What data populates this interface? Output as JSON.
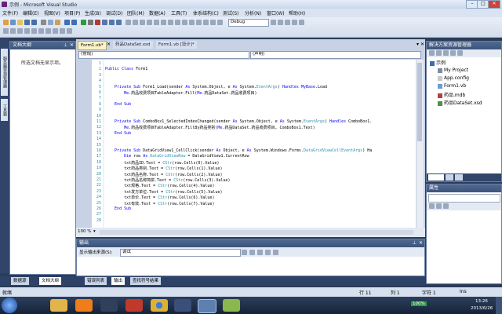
{
  "window": {
    "title": "示例 - Microsoft Visual Studio"
  },
  "menu": [
    "文件(F)",
    "编辑(E)",
    "视图(V)",
    "项目(P)",
    "生成(B)",
    "调试(D)",
    "团队(M)",
    "数据(A)",
    "工具(T)",
    "体系结构(C)",
    "测试(S)",
    "分析(N)",
    "窗口(W)",
    "帮助(H)"
  ],
  "toolbar": {
    "config": "Debug"
  },
  "doc_outline": {
    "title": "文档大纲",
    "message": "所选文档无显示项。"
  },
  "left_side_tabs": [
    "服务器资源管理器",
    "工具箱"
  ],
  "editor": {
    "tabs": [
      "Form1.vb*",
      "药品DataSet.xsd",
      "Form1.vb [设计]*"
    ],
    "left_combo": "(常规)",
    "right_combo": "(声明)",
    "zoom": "100 %",
    "lines": [
      {
        "n": "1",
        "t": ""
      },
      {
        "n": "2",
        "t": "Public Class Form1"
      },
      {
        "n": "3",
        "t": ""
      },
      {
        "n": "4",
        "t": ""
      },
      {
        "n": "5",
        "t": "    Private Sub Form1_Load(sender As System.Object, e As System.EventArgs) Handles MyBase.Load"
      },
      {
        "n": "6",
        "t": "        Me.药品收费项目TableAdapter.Fill(Me.药品DataSet.药品收费项目)"
      },
      {
        "n": "7",
        "t": ""
      },
      {
        "n": "8",
        "t": "    End Sub"
      },
      {
        "n": "9",
        "t": ""
      },
      {
        "n": "10",
        "t": ""
      },
      {
        "n": "11",
        "t": "    Private Sub ComboBox1_SelectedIndexChanged(sender As System.Object, e As System.EventArgs) Handles ComboBox1."
      },
      {
        "n": "12",
        "t": "        Me.药品收费项目TableAdapter.FillBy药品类别(Me.药品DataSet.药品收费项目, ComboBox1.Text)"
      },
      {
        "n": "13",
        "t": "    End Sub"
      },
      {
        "n": "14",
        "t": ""
      },
      {
        "n": "15",
        "t": ""
      },
      {
        "n": "16",
        "t": "    Private Sub DataGridView1_CellClick(sender As Object, e As System.Windows.Forms.DataGridViewCellEventArgs) Ha"
      },
      {
        "n": "17",
        "t": "        Dim row As DataGridViewRow = DataGridView1.CurrentRow"
      },
      {
        "n": "18",
        "t": "        txt药品ID.Text = CStr(row.Cells(0).Value)"
      },
      {
        "n": "19",
        "t": "        txt药品类别.Text = CStr(row.Cells(1).Value)"
      },
      {
        "n": "20",
        "t": "        txt药品名称.Text = CStr(row.Cells(2).Value)"
      },
      {
        "n": "21",
        "t": "        txt药品名称简拼.Text = CStr(row.Cells(3).Value)"
      },
      {
        "n": "22",
        "t": "        txt规格.Text = CStr(row.Cells(4).Value)"
      },
      {
        "n": "23",
        "t": "        txt发方单位.Text = CStr(row.Cells(5).Value)"
      },
      {
        "n": "24",
        "t": "        txt单价.Text = CStr(row.Cells(6).Value)"
      },
      {
        "n": "25",
        "t": "        txt有效.Text = CStr(row.Cells(7).Value)"
      },
      {
        "n": "26",
        "t": "    End Sub"
      },
      {
        "n": "27",
        "t": ""
      },
      {
        "n": "28",
        "t": ""
      }
    ]
  },
  "output": {
    "title": "输出",
    "source_label": "显示输出来源(S):",
    "source_value": "调试"
  },
  "bottom_tabs": [
    "数据源",
    "文档大纲",
    "错误列表",
    "输出",
    "查找符号结果"
  ],
  "solution_explorer": {
    "title": "解决方案资源管理器",
    "items": [
      "示例",
      "My Project",
      "App.config",
      "Form1.vb",
      "药品.mdb",
      "药品DataSet.xsd"
    ]
  },
  "properties": {
    "title": "属性"
  },
  "statusbar": {
    "ready": "就绪",
    "row": "行 11",
    "col": "列 1",
    "char": "字符 1",
    "ins": "Ins"
  },
  "taskbar": {
    "zoom": "100%",
    "time": "13:26",
    "date": "2013/6/26"
  }
}
